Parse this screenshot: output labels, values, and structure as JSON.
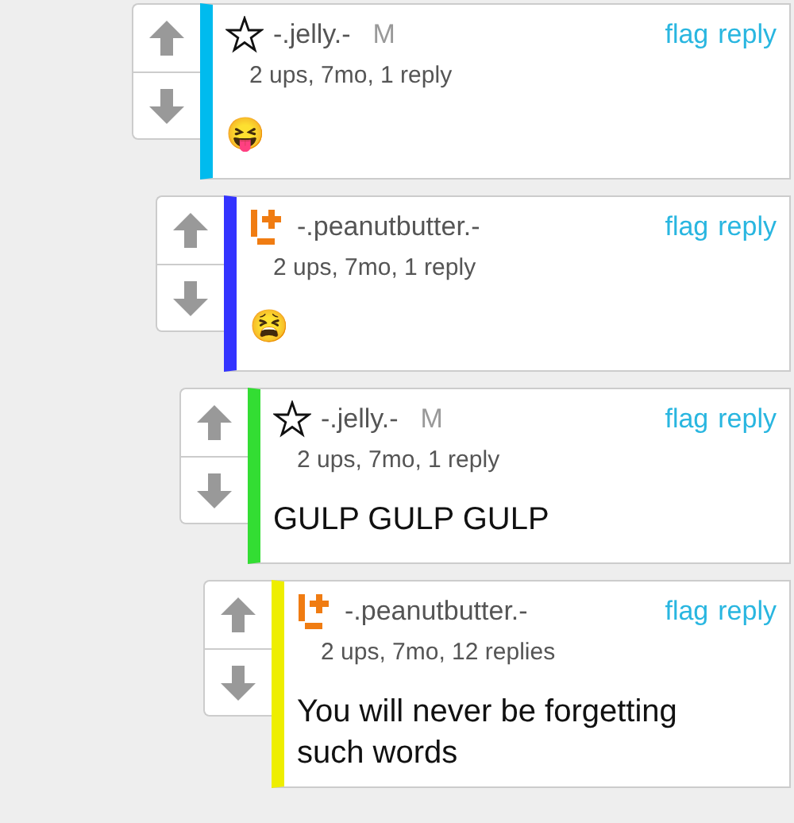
{
  "comments": [
    {
      "kind": "star",
      "user": "-.jelly.-",
      "tag": "M",
      "meta": "2 ups, 7mo, 1 reply",
      "body": "😝",
      "color": "#00bbee",
      "actions": [
        "flag",
        "reply"
      ],
      "children": [
        {
          "kind": "plus",
          "user": "-.peanutbutter.-",
          "meta": "2 ups, 7mo, 1 reply",
          "body": "😫",
          "color": "#3333ff",
          "actions": [
            "flag",
            "reply"
          ],
          "children": [
            {
              "kind": "star",
              "user": "-.jelly.-",
              "tag": "M",
              "meta": "2 ups, 7mo, 1 reply",
              "body": "GULP GULP GULP",
              "color": "#33dd33",
              "actions": [
                "flag",
                "reply"
              ],
              "children": [
                {
                  "kind": "plus",
                  "user": "-.peanutbutter.-",
                  "meta": "2 ups, 7mo, 12 replies",
                  "body": "You will never be forgetting such words",
                  "color": "#eeee00",
                  "actions": [
                    "flag",
                    "reply"
                  ]
                }
              ]
            }
          ]
        }
      ]
    }
  ]
}
